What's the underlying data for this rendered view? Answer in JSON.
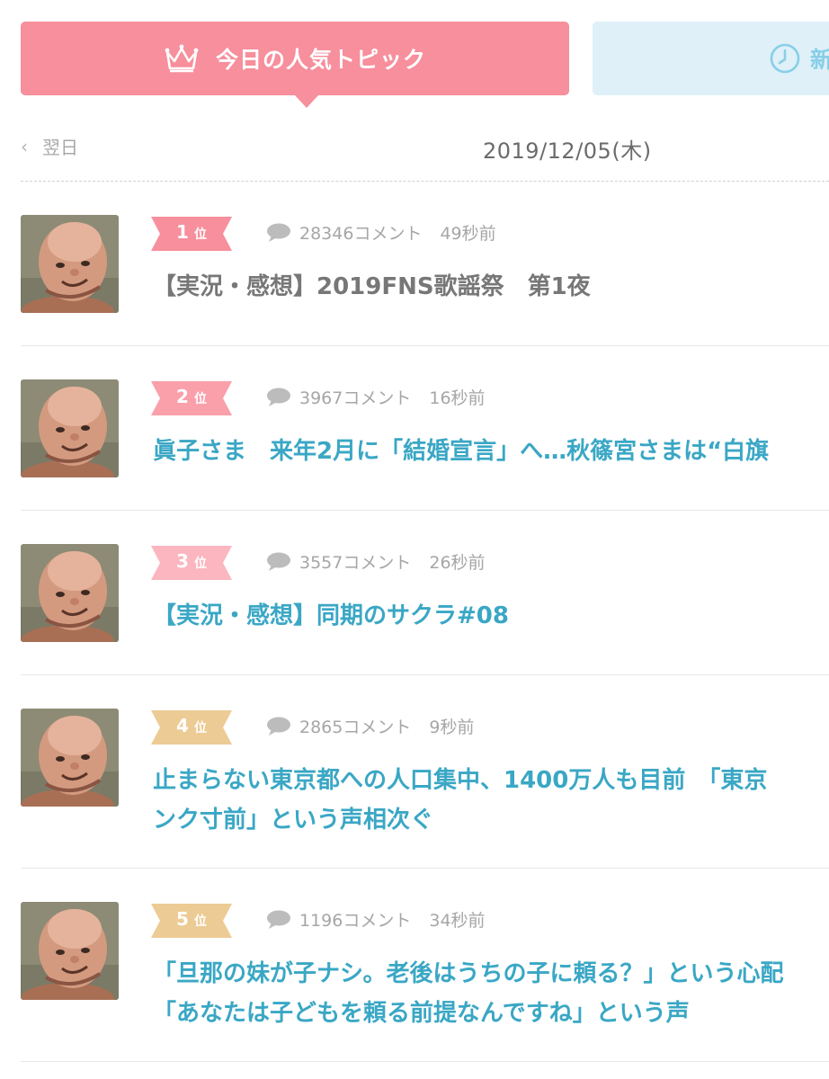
{
  "tabs": {
    "active_label": "今日の人気トピック",
    "inactive_label": "新",
    "active_color": "#f78f9c",
    "inactive_color": "#dff0f8"
  },
  "datebar": {
    "prev_label": "翌日",
    "prev_icon": "chevron-left-icon",
    "date": "2019/12/05(木)"
  },
  "items": [
    {
      "rank_num": "1",
      "rank_suffix": "位",
      "rank_color": "#f78f9c",
      "comments": "28346コメント",
      "time": "49秒前",
      "title_lines": [
        "【実況・感想】2019FNS歌謡祭　第1夜"
      ],
      "visited": true
    },
    {
      "rank_num": "2",
      "rank_suffix": "位",
      "rank_color": "#f9a0ab",
      "comments": "3967コメント",
      "time": "16秒前",
      "title_lines": [
        "眞子さま　来年2月に「結婚宣言」へ…秋篠宮さまは“白旗"
      ],
      "visited": false
    },
    {
      "rank_num": "3",
      "rank_suffix": "位",
      "rank_color": "#fbb6bf",
      "comments": "3557コメント",
      "time": "26秒前",
      "title_lines": [
        "【実況・感想】同期のサクラ#08"
      ],
      "visited": false
    },
    {
      "rank_num": "4",
      "rank_suffix": "位",
      "rank_color": "#eccb94",
      "comments": "2865コメント",
      "time": "9秒前",
      "title_lines": [
        "止まらない東京都への人口集中、1400万人も目前　「東京",
        "ンク寸前」という声相次ぐ"
      ],
      "visited": false
    },
    {
      "rank_num": "5",
      "rank_suffix": "位",
      "rank_color": "#eccb94",
      "comments": "1196コメント",
      "time": "34秒前",
      "title_lines": [
        "「旦那の妹が子ナシ。老後はうちの子に頼る？」という心配",
        "「あなたは子どもを頼る前提なんですね」という声"
      ],
      "visited": false
    }
  ]
}
